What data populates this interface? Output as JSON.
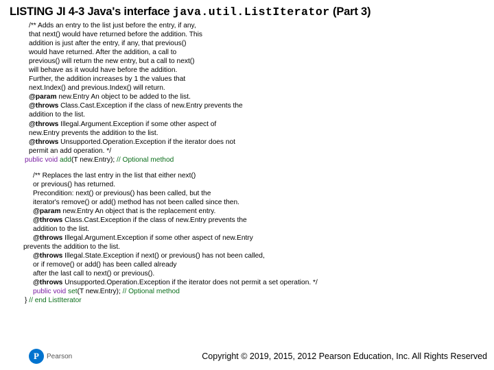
{
  "heading": {
    "prefix": "LISTING JI 4-3 Java's interface ",
    "mono": "java.util.ListIterator",
    "suffix": " (Part 3)"
  },
  "block1": {
    "l1": "/** Adds an entry to the list just before the entry, if any,",
    "l2": "that next() would have returned before the addition. This",
    "l3": "addition is just after the entry, if any, that previous()",
    "l4": "would have returned. After the addition, a call to",
    "l5": "previous() will return the new entry, but a call to next()",
    "l6": "will behave as it would have before the addition.",
    "l7": "Further, the addition increases by 1 the values that",
    "l8": "next.Index() and previous.Index() will return.",
    "param_tag": "@param",
    "param_text": " new.Entry An object to be added to the list.",
    "throws_tag": "@throws",
    "th1a": " Class.Cast.Exception if the class of new.Entry prevents the",
    "th1b": "addition to the list.",
    "th2a": " Illegal.Argument.Exception if some other aspect of",
    "th2b": "new.Entry prevents the addition to the list.",
    "th3a": " Unsupported.Operation.Exception if the iterator does not",
    "th3b": "permit an add operation. */",
    "sig_kw": "public void ",
    "sig_name": "add",
    "sig_rest": "(T new.Entry); ",
    "sig_comment": "// Optional method"
  },
  "block2": {
    "l1": "/** Replaces the last entry in the list that either next()",
    "l2": "or previous() has returned.",
    "l3": "Precondition: next() or previous() has been called, but the",
    "l4": "iterator's remove() or add() method has not been called since then.",
    "param_tag": "@param",
    "param_text": " new.Entry An object that is the replacement entry.",
    "throws_tag": "@throws",
    "th1a": " Class.Cast.Exception if the class of new.Entry prevents the",
    "th1b": "addition to the list.",
    "th2a": " Illegal.Argument.Exception if some other aspect of new.Entry",
    "th2b_outdent": "prevents the addition to the list.",
    "th3a": " Illegal.State.Exception if next() or previous() has not been called,",
    "th3b": "or if remove() or add() has been called already",
    "th3c": "after the last call to next() or previous().",
    "th4": " Unsupported.Operation.Exception if the iterator does not permit a set operation. */",
    "sig_kw": "public void ",
    "sig_name": "set",
    "sig_rest": "(T new.Entry); ",
    "sig_comment": "// Optional method"
  },
  "closer": {
    "brace": "} ",
    "comment": "// end ListIterator"
  },
  "footer": {
    "brand": "Pearson",
    "copyright": "Copyright © 2019, 2015, 2012 Pearson Education, Inc. All Rights Reserved"
  }
}
